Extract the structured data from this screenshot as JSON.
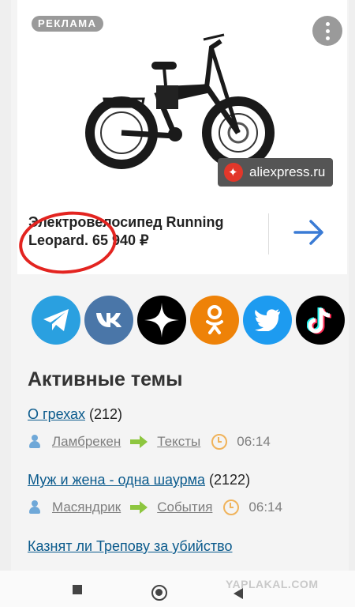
{
  "ad": {
    "badge": "РЕКЛАМА",
    "source": "aliexpress.ru",
    "title": "Электровелосипед Running Leopard. 65 940 ₽"
  },
  "share": [
    "telegram-icon",
    "vk-icon",
    "zen-icon",
    "ok-icon",
    "twitter-icon",
    "tiktok-icon"
  ],
  "topics": {
    "heading": "Активные темы",
    "items": [
      {
        "title": "О грехах",
        "count": "(212)",
        "author": "Ламбрекен",
        "category": "Тексты",
        "time": "06:14"
      },
      {
        "title": "Муж и жена - одна шаурма",
        "count": "(2122)",
        "author": "Масяндрик",
        "category": "События",
        "time": "06:14"
      }
    ],
    "clipped": "Казнят ли Трепову за убийство"
  },
  "watermark": "YAPLAKAL.COM",
  "colors": {
    "link": "#0a5a8c",
    "accent_red": "#e32420",
    "clock": "#f0b35b",
    "user": "#6fa8d8"
  }
}
